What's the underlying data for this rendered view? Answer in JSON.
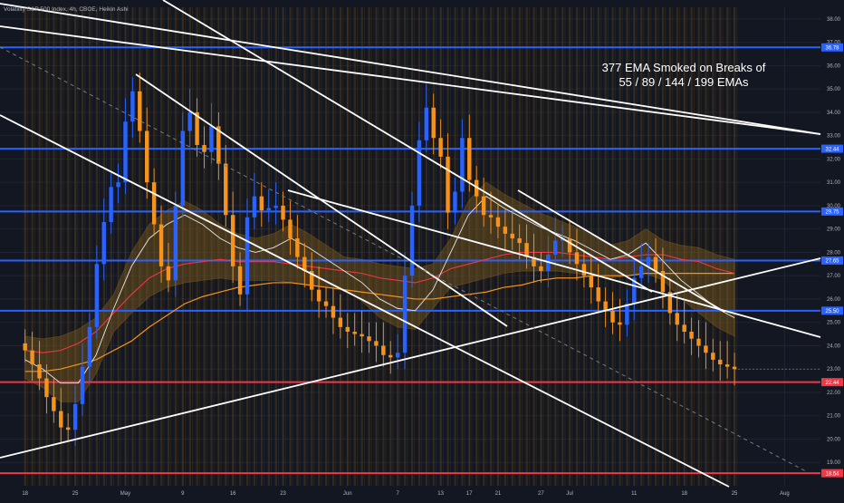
{
  "header": {
    "symbol_line": "Volatility S&P 500 Index, 4h, CBOE, Heikin Ashi"
  },
  "annotation": {
    "line1": "377 EMA Smoked on Breaks of",
    "line2": "55 / 89 / 144 / 199 EMAs"
  },
  "colors": {
    "background": "#131722",
    "candle_up": "#2962ff",
    "candle_down": "#f7931a",
    "level_blue": "#2962ff",
    "level_red": "#f23645",
    "trendline": "#ffffff",
    "cloud": "#7a5a1e",
    "cloud_band": "#2a3f7a"
  },
  "chart_data": {
    "type": "candlestick",
    "title": "Volatility S&P 500 Index, 4h, CBOE, Heikin Ashi",
    "ylim": [
      18.0,
      38.5
    ],
    "y_ticks": [
      {
        "label": "38.00",
        "value": 38.0
      },
      {
        "label": "37.00",
        "value": 37.0
      },
      {
        "label": "36.00",
        "value": 36.0
      },
      {
        "label": "35.00",
        "value": 35.0
      },
      {
        "label": "34.00",
        "value": 34.0
      },
      {
        "label": "33.00",
        "value": 33.0
      },
      {
        "label": "32.00",
        "value": 32.0
      },
      {
        "label": "31.00",
        "value": 31.0
      },
      {
        "label": "30.00",
        "value": 30.0
      },
      {
        "label": "29.00",
        "value": 29.0
      },
      {
        "label": "28.00",
        "value": 28.0
      },
      {
        "label": "27.00",
        "value": 27.0
      },
      {
        "label": "26.00",
        "value": 26.0
      },
      {
        "label": "25.00",
        "value": 25.0
      },
      {
        "label": "24.00",
        "value": 24.0
      },
      {
        "label": "23.00",
        "value": 23.0
      },
      {
        "label": "22.00",
        "value": 22.0
      },
      {
        "label": "21.00",
        "value": 21.0
      },
      {
        "label": "20.00",
        "value": 20.0
      },
      {
        "label": "19.00",
        "value": 19.0
      }
    ],
    "x_ticks": [
      {
        "label": "18",
        "index": 0
      },
      {
        "label": "25",
        "index": 7
      },
      {
        "label": "May",
        "index": 14
      },
      {
        "label": "9",
        "index": 22
      },
      {
        "label": "16",
        "index": 29
      },
      {
        "label": "23",
        "index": 36
      },
      {
        "label": "Jun",
        "index": 45
      },
      {
        "label": "7",
        "index": 52
      },
      {
        "label": "13",
        "index": 58
      },
      {
        "label": "17",
        "index": 62
      },
      {
        "label": "21",
        "index": 66
      },
      {
        "label": "27",
        "index": 72
      },
      {
        "label": "Jul",
        "index": 76
      },
      {
        "label": "11",
        "index": 85
      },
      {
        "label": "18",
        "index": 92
      },
      {
        "label": "25",
        "index": 99
      },
      {
        "label": "Aug",
        "index": 106
      }
    ],
    "x_range": [
      -3.5,
      111
    ],
    "levels": [
      {
        "value": 36.78,
        "label": "36.78",
        "color": "blue"
      },
      {
        "value": 32.44,
        "label": "32.44",
        "color": "blue"
      },
      {
        "value": 29.75,
        "label": "29.75",
        "color": "blue"
      },
      {
        "value": 27.65,
        "label": "27.65",
        "color": "blue"
      },
      {
        "value": 25.5,
        "label": "25.50",
        "color": "blue"
      },
      {
        "value": 22.44,
        "label": "22.44",
        "color": "red"
      },
      {
        "value": 18.54,
        "label": "18.54",
        "color": "red"
      }
    ],
    "close_series": [
      23.8,
      23.2,
      22.6,
      21.8,
      21.2,
      20.5,
      20.4,
      21.5,
      23.1,
      24.8,
      27.5,
      29.3,
      30.8,
      31.0,
      33.6,
      34.9,
      33.2,
      31.0,
      29.2,
      27.4,
      26.8,
      30.0,
      33.2,
      34.0,
      32.6,
      32.3,
      33.4,
      31.8,
      29.6,
      27.4,
      26.2,
      29.5,
      30.4,
      29.8,
      29.9,
      30.0,
      29.4,
      28.6,
      27.8,
      27.2,
      26.4,
      25.9,
      25.7,
      25.2,
      24.8,
      24.6,
      24.5,
      24.4,
      24.2,
      24.0,
      23.6,
      23.5,
      23.7,
      27.0,
      30.0,
      32.8,
      34.2,
      32.9,
      32.1,
      29.7,
      30.6,
      32.9,
      31.1,
      30.4,
      29.6,
      29.5,
      29.1,
      28.8,
      28.6,
      28.4,
      27.8,
      27.4,
      27.2,
      27.9,
      28.5,
      28.6,
      28.0,
      27.5,
      27.0,
      26.5,
      25.9,
      25.5,
      25.0,
      24.9,
      25.8,
      26.9,
      27.4,
      27.8,
      27.2,
      26.3,
      25.4,
      24.9,
      24.6,
      24.3,
      24.0,
      23.7,
      23.4,
      23.2,
      23.1,
      23.0
    ],
    "ema_377": [
      22.9,
      22.9,
      23.0,
      23.2,
      23.4,
      23.8,
      24.2,
      24.8,
      25.3,
      25.8,
      26.1,
      26.3,
      26.5,
      26.6,
      26.7,
      26.7,
      26.6,
      26.5,
      26.4,
      26.3,
      26.2,
      26.1,
      26.0,
      26.0,
      26.1,
      26.2,
      26.3,
      26.5,
      26.6,
      26.8,
      26.9,
      26.9,
      27.0,
      27.0,
      27.0,
      27.1,
      27.1,
      27.1,
      27.1,
      27.1,
      27.1
    ],
    "ema_199": [
      23.8,
      23.7,
      23.8,
      24.1,
      24.6,
      25.4,
      26.2,
      26.9,
      27.3,
      27.5,
      27.6,
      27.7,
      27.6,
      27.6,
      27.6,
      27.5,
      27.4,
      27.3,
      27.2,
      27.1,
      26.9,
      26.8,
      26.7,
      26.9,
      27.3,
      27.5,
      27.7,
      27.9,
      28.0,
      28.0,
      28.0,
      27.9,
      27.8,
      27.7,
      27.8,
      27.9,
      27.9,
      27.7,
      27.6,
      27.3,
      27.1
    ],
    "ema_55": [
      23.4,
      23.0,
      22.4,
      22.4,
      23.6,
      25.6,
      27.4,
      28.6,
      29.2,
      29.6,
      29.2,
      28.6,
      28.2,
      28.0,
      28.2,
      28.6,
      28.2,
      27.7,
      27.2,
      26.7,
      26.0,
      25.6,
      25.5,
      26.4,
      28.0,
      29.6,
      30.4,
      29.9,
      29.5,
      29.1,
      28.8,
      28.5,
      28.1,
      27.7,
      27.9,
      28.4,
      27.6,
      26.8,
      26.2,
      25.6,
      25.2
    ]
  }
}
